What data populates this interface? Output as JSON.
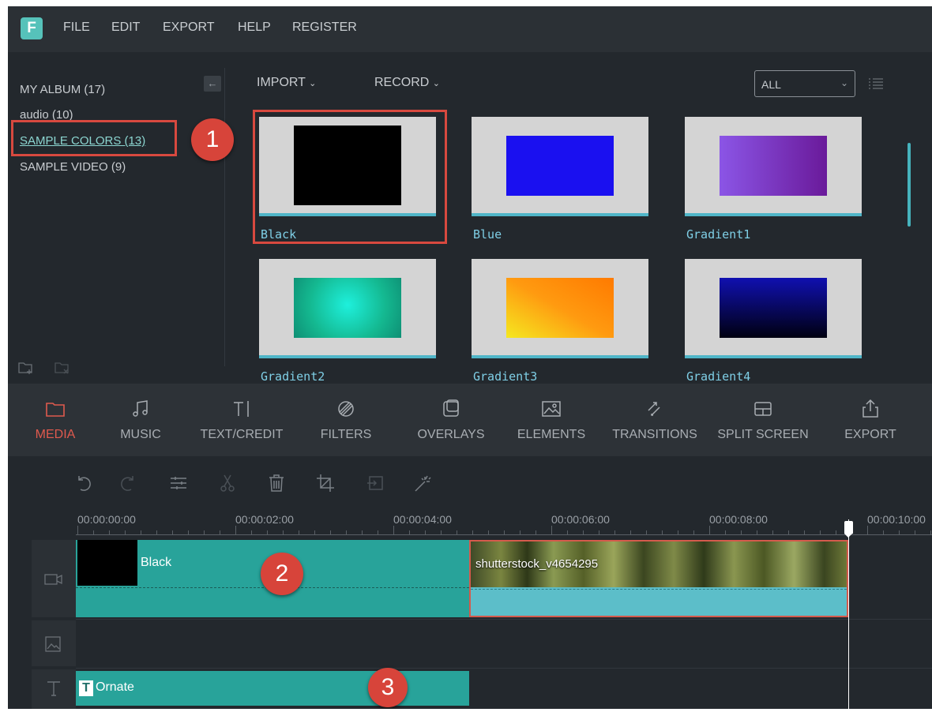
{
  "menu": {
    "logo": "F",
    "items": [
      "FILE",
      "EDIT",
      "EXPORT",
      "HELP",
      "REGISTER"
    ]
  },
  "albums": {
    "items": [
      "MY ALBUM (17)",
      "audio (10)",
      "SAMPLE COLORS (13)",
      "SAMPLE VIDEO (9)"
    ],
    "selected_index": 2,
    "collapse_icon": "arrow-left-icon"
  },
  "media_bar": {
    "import_label": "IMPORT",
    "record_label": "RECORD",
    "filter_value": "ALL"
  },
  "thumbnails": [
    {
      "label": "Black",
      "fill": "#000000"
    },
    {
      "label": "Blue",
      "fill": "#1a10f0"
    },
    {
      "label": "Gradient1",
      "fill": "linear-gradient(90deg,#8b55e6,#6a1a9a)"
    },
    {
      "label": "Gradient2",
      "fill": "radial-gradient(circle at 50% 45%,#1ef0dc,#14b890 60%,#0e8f74)"
    },
    {
      "label": "Gradient3",
      "fill": "linear-gradient(30deg,#f5e820,#ff9a10 50%,#ff7a00)"
    },
    {
      "label": "Gradient4",
      "fill": "linear-gradient(180deg,#1010b0,#050540 70%,#000010)"
    }
  ],
  "callouts": [
    "1",
    "2",
    "3"
  ],
  "tools": [
    {
      "label": "MEDIA",
      "icon": "folder-icon",
      "active": true
    },
    {
      "label": "MUSIC",
      "icon": "music-note-icon"
    },
    {
      "label": "TEXT/CREDIT",
      "icon": "text-cursor-icon"
    },
    {
      "label": "FILTERS",
      "icon": "filters-icon"
    },
    {
      "label": "OVERLAYS",
      "icon": "overlays-icon"
    },
    {
      "label": "ELEMENTS",
      "icon": "image-icon"
    },
    {
      "label": "TRANSITIONS",
      "icon": "transitions-icon"
    },
    {
      "label": "SPLIT SCREEN",
      "icon": "split-screen-icon"
    },
    {
      "label": "EXPORT",
      "icon": "share-icon"
    }
  ],
  "edit_tools": [
    "undo-icon",
    "redo-icon",
    "adjust-icon",
    "cut-icon",
    "delete-icon",
    "crop-icon",
    "detach-icon",
    "magic-wand-icon"
  ],
  "ruler": {
    "labels": [
      "00:00:00:00",
      "00:00:02:00",
      "00:00:04:00",
      "00:00:06:00",
      "00:00:08:00",
      "00:00:10:00"
    ]
  },
  "timeline": {
    "video_clip_1": "Black",
    "video_clip_2": "shutterstock_v4654295",
    "title_clip_icon": "T",
    "title_clip": "Ornate",
    "track_icons": [
      "video-track-icon",
      "image-track-icon",
      "text-track-icon"
    ]
  }
}
